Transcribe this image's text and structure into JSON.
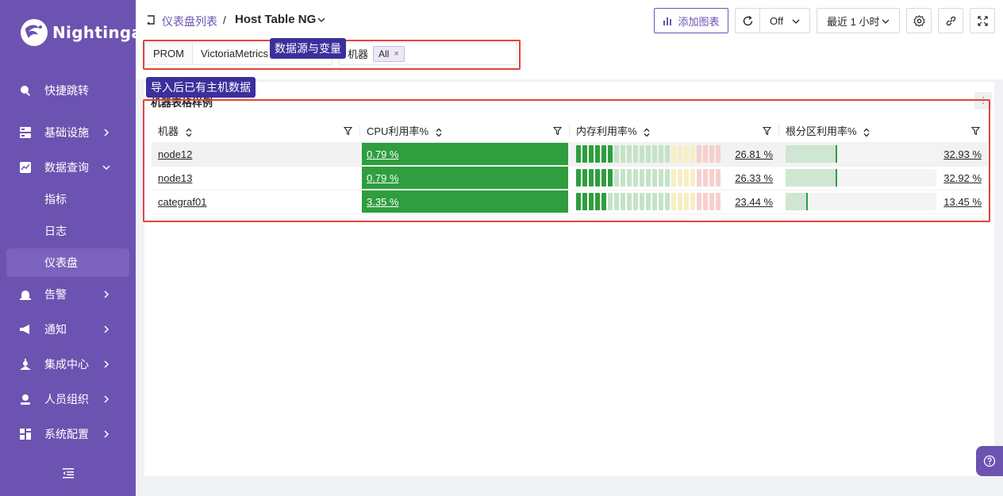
{
  "app": {
    "name": "Nightingale"
  },
  "sidebar": {
    "items": [
      {
        "label": "快捷跳转",
        "icon": "search-icon"
      },
      {
        "label": "基础设施",
        "icon": "server-icon"
      },
      {
        "label": "数据查询",
        "icon": "chart-icon"
      },
      {
        "label": "告警",
        "icon": "alarm-bell-icon"
      },
      {
        "label": "通知",
        "icon": "megaphone-icon"
      },
      {
        "label": "集成中心",
        "icon": "integration-icon"
      },
      {
        "label": "人员组织",
        "icon": "user-icon"
      },
      {
        "label": "系统配置",
        "icon": "settings-grid-icon"
      }
    ],
    "subitems": [
      {
        "label": "指标"
      },
      {
        "label": "日志"
      },
      {
        "label": "仪表盘",
        "active": true
      }
    ]
  },
  "header": {
    "breadcrumb_link": "仪表盘列表",
    "separator": "/",
    "title": "Host Table NG",
    "add_chart": "添加图表",
    "refresh_interval": "Off",
    "time_range": "最近 1 小时"
  },
  "variables": {
    "datasource_label": "PROM",
    "datasource_value": "VictoriaMetrics",
    "host_label": "机器",
    "host_value": "All"
  },
  "annotations": {
    "datasource_tip": "数据源与变量",
    "data_tip": "导入后已有主机数据"
  },
  "panel": {
    "title": "机器表格样例",
    "columns": [
      "机器",
      "CPU利用率%",
      "内存利用率%",
      "根分区利用率%"
    ],
    "rows": [
      {
        "host": "node12",
        "cpu": "0.79 %",
        "mem": "26.81 %",
        "mem_pct": 26.81,
        "disk": "32.93 %",
        "disk_pct": 32.93
      },
      {
        "host": "node13",
        "cpu": "0.79 %",
        "mem": "26.33 %",
        "mem_pct": 26.33,
        "disk": "32.92 %",
        "disk_pct": 32.92
      },
      {
        "host": "categraf01",
        "cpu": "3.35 %",
        "mem": "23.44 %",
        "mem_pct": 23.44,
        "disk": "13.45 %",
        "disk_pct": 13.45
      }
    ]
  },
  "colors": {
    "brand": "#6c53b1",
    "cpu_bar": "#2e9e3e",
    "annotation_border": "#e0443b",
    "tooltip": "#3b2f9b"
  }
}
